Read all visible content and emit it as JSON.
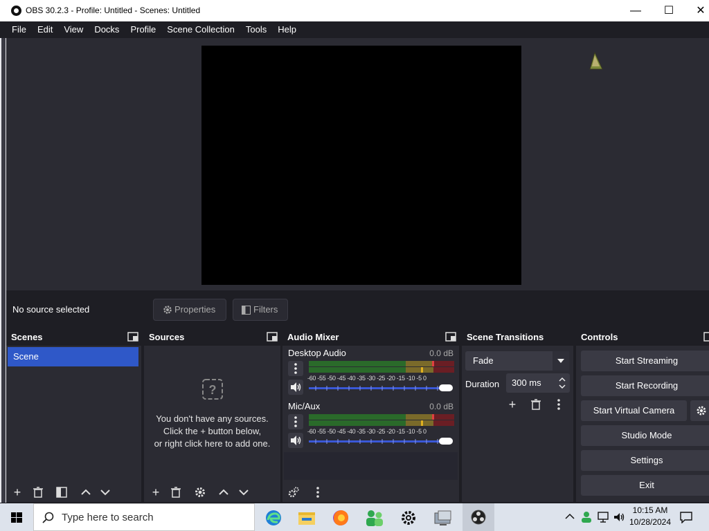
{
  "window": {
    "title": "OBS 30.2.3 - Profile: Untitled - Scenes: Untitled",
    "minimize_label": "—",
    "maximize_label": "☐",
    "close_label": "✕"
  },
  "menu": {
    "items": [
      "File",
      "Edit",
      "View",
      "Docks",
      "Profile",
      "Scene Collection",
      "Tools",
      "Help"
    ]
  },
  "source_toolbar": {
    "status": "No source selected",
    "properties_label": "Properties",
    "filters_label": "Filters"
  },
  "scenes": {
    "title": "Scenes",
    "items": [
      "Scene"
    ]
  },
  "sources": {
    "title": "Sources",
    "empty_line1": "You don't have any sources.",
    "empty_line2": "Click the + button below,",
    "empty_line3": "or right click here to add one."
  },
  "audio_mixer": {
    "title": "Audio Mixer",
    "channels": [
      {
        "name": "Desktop Audio",
        "db": "0.0 dB",
        "volume_percent": 100
      },
      {
        "name": "Mic/Aux",
        "db": "0.0 dB",
        "volume_percent": 100
      }
    ],
    "meter_ticks": "-60 -55 -50 -45 -40 -35 -30 -25 -20 -15 -10 -5 0"
  },
  "scene_transitions": {
    "title": "Scene Transitions",
    "transition": "Fade",
    "duration_label": "Duration",
    "duration_value": "300 ms"
  },
  "controls": {
    "title": "Controls",
    "start_streaming": "Start Streaming",
    "start_recording": "Start Recording",
    "start_virtual_camera": "Start Virtual Camera",
    "studio_mode": "Studio Mode",
    "settings": "Settings",
    "exit": "Exit"
  },
  "taskbar": {
    "search_placeholder": "Type here to search",
    "time": "10:15 AM",
    "date": "10/28/2024"
  },
  "colors": {
    "accent": "#2f58c8",
    "panel": "#2b2b33",
    "background": "#1e1e24",
    "button": "#3a3a44"
  }
}
